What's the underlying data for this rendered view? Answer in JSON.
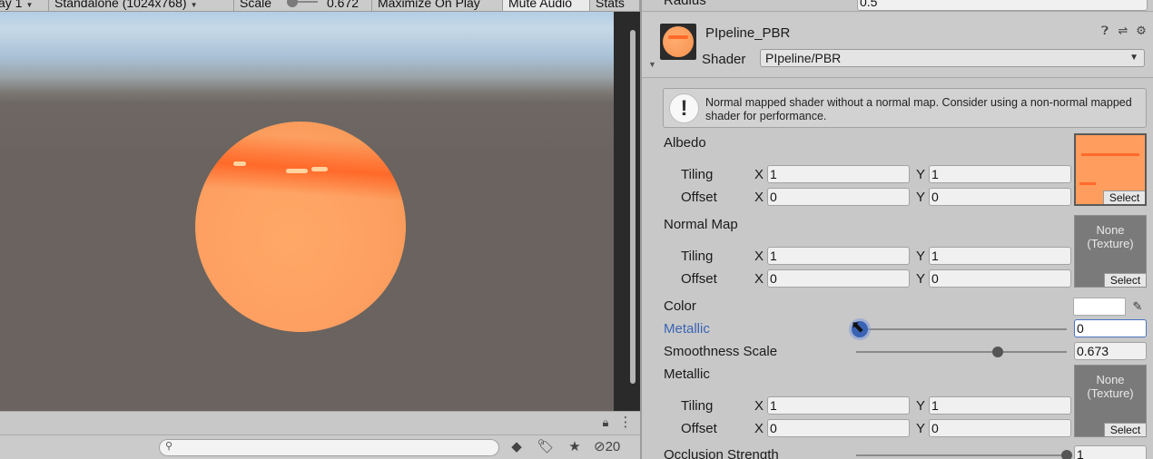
{
  "game_view": {
    "toolbar": {
      "display_label": "ay 1",
      "resolution_label": "Standalone (1024x768)",
      "scale_label": "Scale",
      "scale_value": "0.672",
      "maximize_label": "Maximize On Play",
      "mute_label": "Mute Audio",
      "stats_label": "Stats"
    },
    "bottom_bar": {
      "search_placeholder": "",
      "hidden_count": "20",
      "icons": [
        "lock-icon",
        "more-icon",
        "filter-by-type-icon",
        "label-icon",
        "favorite-star-icon",
        "hidden-eye-icon"
      ]
    }
  },
  "inspector": {
    "radius_label": "Radius",
    "radius_value": "0.5",
    "material": {
      "name": "PIpeline_PBR",
      "shader_label": "Shader",
      "shader_value": "PIpeline/PBR"
    },
    "help_message": "Normal mapped shader without a normal map. Consider using a non-normal mapped shader for performance.",
    "properties": {
      "albedo": {
        "label": "Albedo",
        "tiling_label": "Tiling",
        "tiling_x": "1",
        "tiling_y": "1",
        "offset_label": "Offset",
        "offset_x": "0",
        "offset_y": "0",
        "select_label": "Select"
      },
      "normal_map": {
        "label": "Normal Map",
        "tiling_label": "Tiling",
        "tiling_x": "1",
        "tiling_y": "1",
        "offset_label": "Offset",
        "offset_x": "0",
        "offset_y": "0",
        "none_label": "None\n(Texture)",
        "select_label": "Select"
      },
      "color_label": "Color",
      "color_value": "#ffffff",
      "metallic_slider": {
        "label": "Metallic",
        "value": "0",
        "fraction": 0.0
      },
      "smoothness": {
        "label": "Smoothness Scale",
        "value": "0.673",
        "fraction": 0.673
      },
      "metallic_map": {
        "label": "Metallic",
        "tiling_label": "Tiling",
        "tiling_x": "1",
        "tiling_y": "1",
        "offset_label": "Offset",
        "offset_x": "0",
        "offset_y": "0",
        "none_label": "None\n(Texture)",
        "select_label": "Select"
      },
      "occlusion": {
        "label": "Occlusion Strength",
        "value": "1",
        "fraction": 1.0
      }
    },
    "axis_x": "X",
    "axis_y": "Y"
  },
  "colors": {
    "accent": "#3a64b3",
    "sphere": "#fda062",
    "sphere_band": "#ff6a2a"
  }
}
